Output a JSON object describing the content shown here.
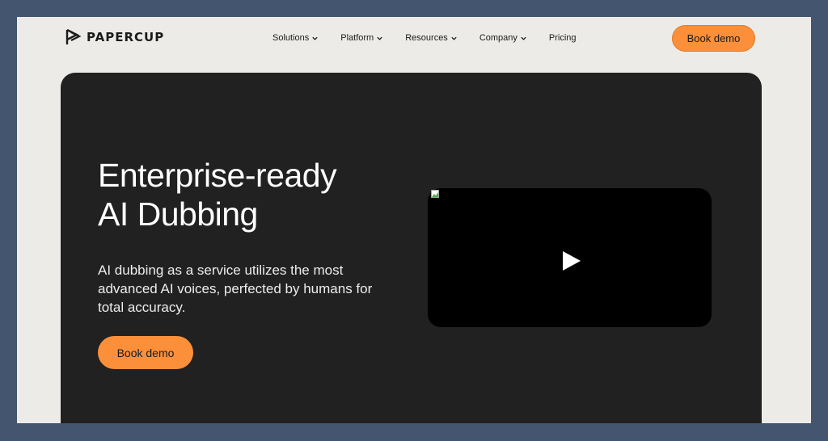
{
  "brand": {
    "name": "PAPERCUP",
    "logo_icon": "papercup-logo-icon"
  },
  "nav": {
    "items": [
      {
        "label": "Solutions",
        "dropdown": true
      },
      {
        "label": "Platform",
        "dropdown": true
      },
      {
        "label": "Resources",
        "dropdown": true
      },
      {
        "label": "Company",
        "dropdown": true
      },
      {
        "label": "Pricing",
        "dropdown": false
      }
    ],
    "cta_label": "Book demo"
  },
  "hero": {
    "title_lines": [
      "Enterprise-ready",
      "AI Dubbing"
    ],
    "description_lines": [
      "AI dubbing as a service utilizes the most",
      "advanced AI voices, perfected by humans for",
      "total accuracy."
    ],
    "cta_label": "Book demo",
    "video": {
      "play_icon": "play-icon",
      "broken_image_icon": "broken-image-icon"
    }
  },
  "colors": {
    "page_bg": "#edebe8",
    "outer_bg": "#44556f",
    "hero_bg": "#212121",
    "accent": "#fb8f3a",
    "text_dark": "#1b1b1b",
    "text_light": "#ffffff"
  }
}
